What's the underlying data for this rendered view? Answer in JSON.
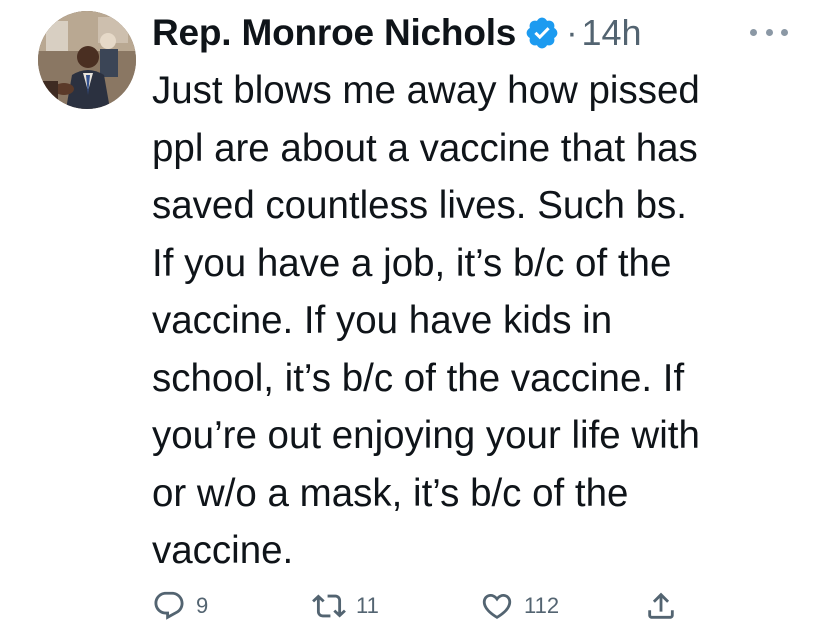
{
  "tweet": {
    "author_name": "Rep. Monroe Nichols",
    "separator": "·",
    "timestamp": "14h",
    "lines": [
      "Just blows me away how pissed",
      "ppl are about a vaccine that has",
      "saved countless lives. Such bs.",
      "If you have a job, it’s b/c of the",
      "vaccine. If you have kids in",
      "school, it’s b/c of the vaccine. If",
      "you’re out enjoying your life with",
      "or w/o a mask, it’s b/c of the",
      "vaccine."
    ]
  },
  "actions": {
    "reply_count": "9",
    "retweet_count": "11",
    "like_count": "112"
  },
  "icons": {
    "verified": "verified-badge-icon",
    "more": "more-dots-icon",
    "reply": "reply-bubble-icon",
    "retweet": "retweet-icon",
    "like": "heart-icon",
    "share": "share-upload-icon"
  },
  "colors": {
    "text": "#0f1419",
    "secondary": "#536471",
    "verified_blue": "#1d9bf0"
  }
}
